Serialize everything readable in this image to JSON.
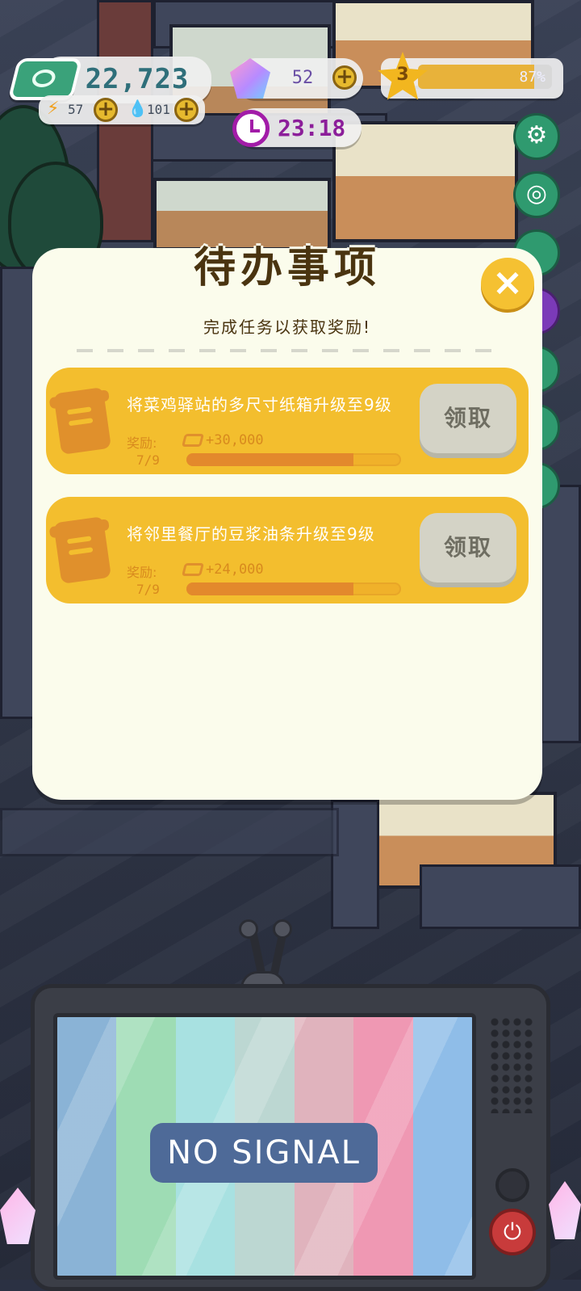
{
  "hud": {
    "money": "22,723",
    "energy": "57",
    "water": "101",
    "gems": "52",
    "time": "23:18",
    "level": "3",
    "xp_percent_label": "87%",
    "xp_fraction": 0.87
  },
  "dialog": {
    "title": "待办事项",
    "subtitle": "完成任务以获取奖励!",
    "close_label": "×",
    "tasks": [
      {
        "name": "将菜鸡驿站的多尺寸纸箱升级至9级",
        "reward_label": "奖励:",
        "reward_value": "+30,000",
        "progress_label": "7/9",
        "progress_fraction": 0.778,
        "claim_label": "领取"
      },
      {
        "name": "将邻里餐厅的豆浆油条升级至9级",
        "reward_label": "奖励:",
        "reward_value": "+24,000",
        "progress_label": "7/9",
        "progress_fraction": 0.778,
        "claim_label": "领取"
      }
    ]
  },
  "tv": {
    "message": "NO SIGNAL",
    "stripe_colors": [
      "#8ab3d6",
      "#9edcb4",
      "#a8e1e1",
      "#bcd7d2",
      "#e0b3bd",
      "#ef98b3",
      "#8fbde8"
    ]
  },
  "icons": {
    "money": "banknote-icon",
    "energy": "lightning-icon",
    "water": "water-drop-icon",
    "gem": "gem-icon",
    "clock": "clock-icon",
    "star": "star-icon",
    "settings": "gear-icon",
    "close": "close-icon",
    "task": "notepad-icon"
  },
  "colors": {
    "accent_yellow": "#f3be2e",
    "money_green": "#3aa27a",
    "clock_purple": "#a21ca8",
    "dialog_bg": "#fbfcec"
  }
}
